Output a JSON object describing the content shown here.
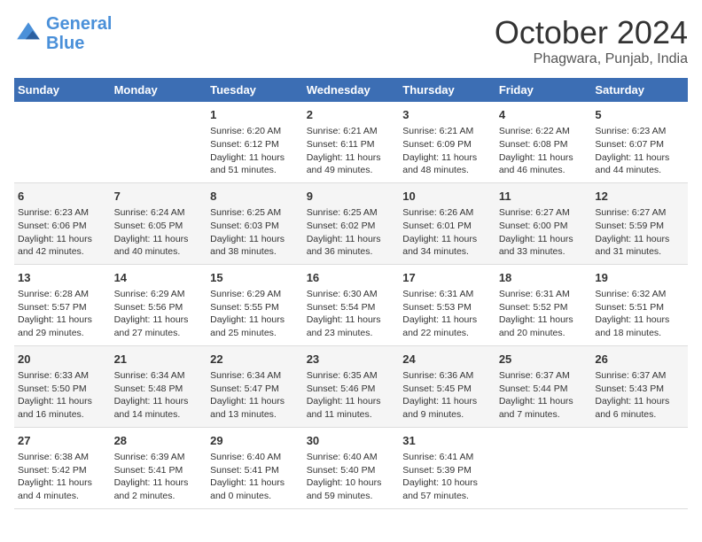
{
  "logo": {
    "general": "General",
    "blue": "Blue"
  },
  "title": "October 2024",
  "location": "Phagwara, Punjab, India",
  "days_of_week": [
    "Sunday",
    "Monday",
    "Tuesday",
    "Wednesday",
    "Thursday",
    "Friday",
    "Saturday"
  ],
  "weeks": [
    [
      {
        "day": "",
        "info": ""
      },
      {
        "day": "",
        "info": ""
      },
      {
        "day": "1",
        "info": "Sunrise: 6:20 AM\nSunset: 6:12 PM\nDaylight: 11 hours and 51 minutes."
      },
      {
        "day": "2",
        "info": "Sunrise: 6:21 AM\nSunset: 6:11 PM\nDaylight: 11 hours and 49 minutes."
      },
      {
        "day": "3",
        "info": "Sunrise: 6:21 AM\nSunset: 6:09 PM\nDaylight: 11 hours and 48 minutes."
      },
      {
        "day": "4",
        "info": "Sunrise: 6:22 AM\nSunset: 6:08 PM\nDaylight: 11 hours and 46 minutes."
      },
      {
        "day": "5",
        "info": "Sunrise: 6:23 AM\nSunset: 6:07 PM\nDaylight: 11 hours and 44 minutes."
      }
    ],
    [
      {
        "day": "6",
        "info": "Sunrise: 6:23 AM\nSunset: 6:06 PM\nDaylight: 11 hours and 42 minutes."
      },
      {
        "day": "7",
        "info": "Sunrise: 6:24 AM\nSunset: 6:05 PM\nDaylight: 11 hours and 40 minutes."
      },
      {
        "day": "8",
        "info": "Sunrise: 6:25 AM\nSunset: 6:03 PM\nDaylight: 11 hours and 38 minutes."
      },
      {
        "day": "9",
        "info": "Sunrise: 6:25 AM\nSunset: 6:02 PM\nDaylight: 11 hours and 36 minutes."
      },
      {
        "day": "10",
        "info": "Sunrise: 6:26 AM\nSunset: 6:01 PM\nDaylight: 11 hours and 34 minutes."
      },
      {
        "day": "11",
        "info": "Sunrise: 6:27 AM\nSunset: 6:00 PM\nDaylight: 11 hours and 33 minutes."
      },
      {
        "day": "12",
        "info": "Sunrise: 6:27 AM\nSunset: 5:59 PM\nDaylight: 11 hours and 31 minutes."
      }
    ],
    [
      {
        "day": "13",
        "info": "Sunrise: 6:28 AM\nSunset: 5:57 PM\nDaylight: 11 hours and 29 minutes."
      },
      {
        "day": "14",
        "info": "Sunrise: 6:29 AM\nSunset: 5:56 PM\nDaylight: 11 hours and 27 minutes."
      },
      {
        "day": "15",
        "info": "Sunrise: 6:29 AM\nSunset: 5:55 PM\nDaylight: 11 hours and 25 minutes."
      },
      {
        "day": "16",
        "info": "Sunrise: 6:30 AM\nSunset: 5:54 PM\nDaylight: 11 hours and 23 minutes."
      },
      {
        "day": "17",
        "info": "Sunrise: 6:31 AM\nSunset: 5:53 PM\nDaylight: 11 hours and 22 minutes."
      },
      {
        "day": "18",
        "info": "Sunrise: 6:31 AM\nSunset: 5:52 PM\nDaylight: 11 hours and 20 minutes."
      },
      {
        "day": "19",
        "info": "Sunrise: 6:32 AM\nSunset: 5:51 PM\nDaylight: 11 hours and 18 minutes."
      }
    ],
    [
      {
        "day": "20",
        "info": "Sunrise: 6:33 AM\nSunset: 5:50 PM\nDaylight: 11 hours and 16 minutes."
      },
      {
        "day": "21",
        "info": "Sunrise: 6:34 AM\nSunset: 5:48 PM\nDaylight: 11 hours and 14 minutes."
      },
      {
        "day": "22",
        "info": "Sunrise: 6:34 AM\nSunset: 5:47 PM\nDaylight: 11 hours and 13 minutes."
      },
      {
        "day": "23",
        "info": "Sunrise: 6:35 AM\nSunset: 5:46 PM\nDaylight: 11 hours and 11 minutes."
      },
      {
        "day": "24",
        "info": "Sunrise: 6:36 AM\nSunset: 5:45 PM\nDaylight: 11 hours and 9 minutes."
      },
      {
        "day": "25",
        "info": "Sunrise: 6:37 AM\nSunset: 5:44 PM\nDaylight: 11 hours and 7 minutes."
      },
      {
        "day": "26",
        "info": "Sunrise: 6:37 AM\nSunset: 5:43 PM\nDaylight: 11 hours and 6 minutes."
      }
    ],
    [
      {
        "day": "27",
        "info": "Sunrise: 6:38 AM\nSunset: 5:42 PM\nDaylight: 11 hours and 4 minutes."
      },
      {
        "day": "28",
        "info": "Sunrise: 6:39 AM\nSunset: 5:41 PM\nDaylight: 11 hours and 2 minutes."
      },
      {
        "day": "29",
        "info": "Sunrise: 6:40 AM\nSunset: 5:41 PM\nDaylight: 11 hours and 0 minutes."
      },
      {
        "day": "30",
        "info": "Sunrise: 6:40 AM\nSunset: 5:40 PM\nDaylight: 10 hours and 59 minutes."
      },
      {
        "day": "31",
        "info": "Sunrise: 6:41 AM\nSunset: 5:39 PM\nDaylight: 10 hours and 57 minutes."
      },
      {
        "day": "",
        "info": ""
      },
      {
        "day": "",
        "info": ""
      }
    ]
  ]
}
